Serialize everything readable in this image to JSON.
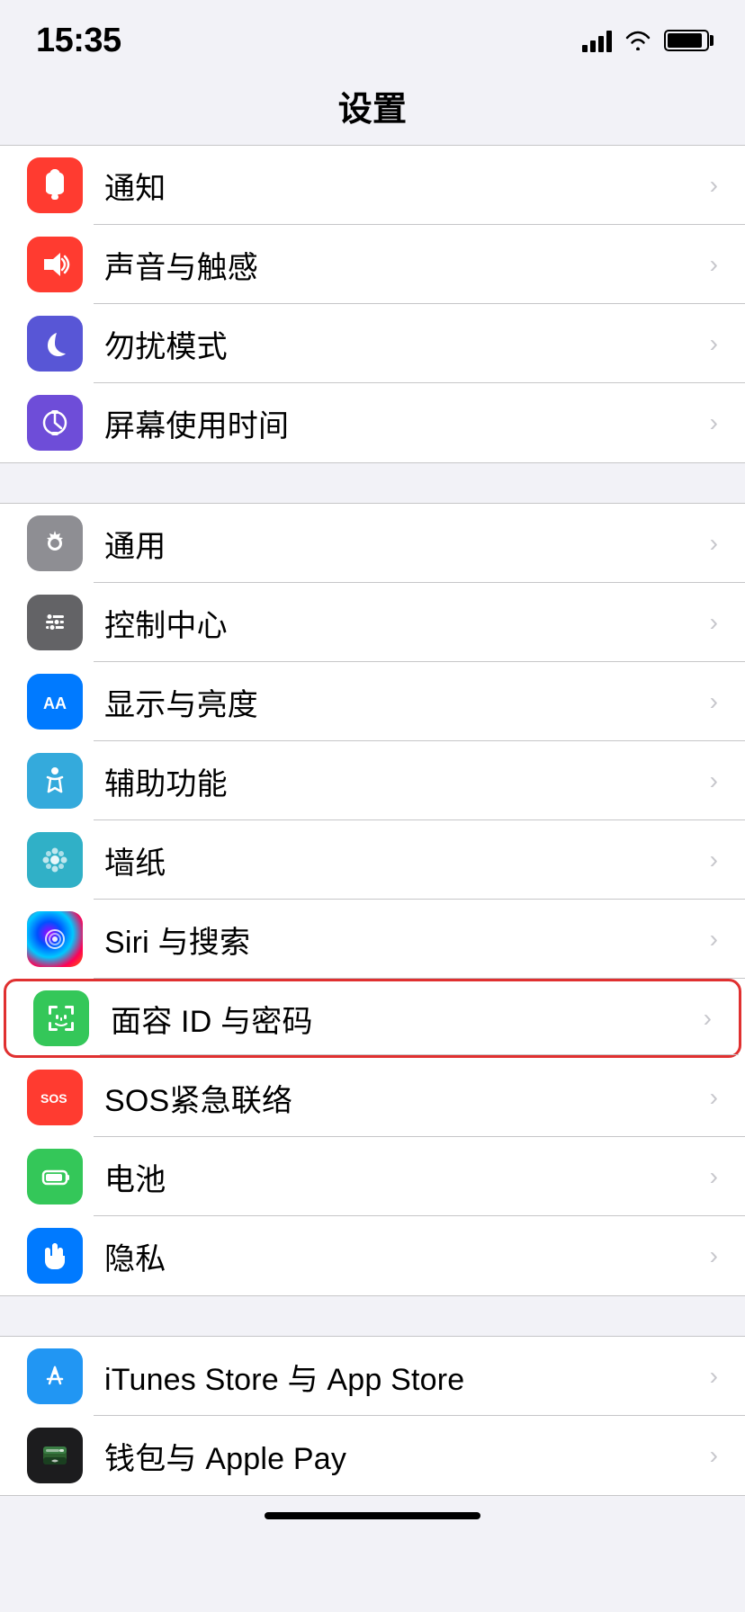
{
  "status_bar": {
    "time": "15:35"
  },
  "page": {
    "title": "设置"
  },
  "sections": [
    {
      "id": "section1",
      "items": [
        {
          "id": "notifications",
          "label": "通知",
          "icon_color": "bg-red",
          "icon_type": "notification",
          "highlighted": false
        },
        {
          "id": "sounds",
          "label": "声音与触感",
          "icon_color": "bg-red2",
          "icon_type": "sound",
          "highlighted": false
        },
        {
          "id": "dnd",
          "label": "勿扰模式",
          "icon_color": "bg-purple",
          "icon_type": "moon",
          "highlighted": false
        },
        {
          "id": "screentime",
          "label": "屏幕使用时间",
          "icon_color": "bg-purple2",
          "icon_type": "hourglass",
          "highlighted": false
        }
      ]
    },
    {
      "id": "section2",
      "items": [
        {
          "id": "general",
          "label": "通用",
          "icon_color": "bg-gray",
          "icon_type": "gear",
          "highlighted": false
        },
        {
          "id": "control",
          "label": "控制中心",
          "icon_color": "bg-gray2",
          "icon_type": "sliders",
          "highlighted": false
        },
        {
          "id": "display",
          "label": "显示与亮度",
          "icon_color": "bg-blue",
          "icon_type": "aa",
          "highlighted": false
        },
        {
          "id": "accessibility",
          "label": "辅助功能",
          "icon_color": "bg-blue2",
          "icon_type": "accessibility",
          "highlighted": false
        },
        {
          "id": "wallpaper",
          "label": "墙纸",
          "icon_color": "bg-teal",
          "icon_type": "wallpaper",
          "highlighted": false
        },
        {
          "id": "siri",
          "label": "Siri 与搜索",
          "icon_color": "bg-siri",
          "icon_type": "siri",
          "highlighted": false
        },
        {
          "id": "faceid",
          "label": "面容 ID 与密码",
          "icon_color": "bg-green2",
          "icon_type": "faceid",
          "highlighted": true
        },
        {
          "id": "sos",
          "label": "SOS紧急联络",
          "icon_color": "bg-sos",
          "icon_type": "sos",
          "highlighted": false
        },
        {
          "id": "battery",
          "label": "电池",
          "icon_color": "bg-green",
          "icon_type": "battery",
          "highlighted": false
        },
        {
          "id": "privacy",
          "label": "隐私",
          "icon_color": "bg-blue",
          "icon_type": "hand",
          "highlighted": false
        }
      ]
    },
    {
      "id": "section3",
      "items": [
        {
          "id": "itunes",
          "label": "iTunes Store 与 App Store",
          "icon_color": "bg-itunes",
          "icon_type": "itunes",
          "highlighted": false
        },
        {
          "id": "wallet",
          "label": "钱包与 Apple Pay",
          "icon_color": "bg-wallet",
          "icon_type": "wallet",
          "highlighted": false
        }
      ]
    }
  ]
}
